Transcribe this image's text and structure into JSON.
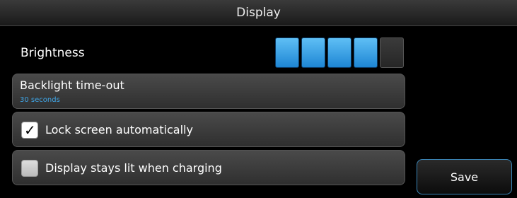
{
  "header": {
    "title": "Display"
  },
  "brightness": {
    "label": "Brightness",
    "level": 4,
    "max": 5,
    "accent": "#1e86d4"
  },
  "backlight": {
    "title": "Backlight time-out",
    "value": "30 seconds"
  },
  "lock_screen": {
    "label": "Lock screen automatically",
    "checked": true
  },
  "display_lit": {
    "label": "Display stays lit when charging",
    "checked": false
  },
  "actions": {
    "save_label": "Save"
  }
}
